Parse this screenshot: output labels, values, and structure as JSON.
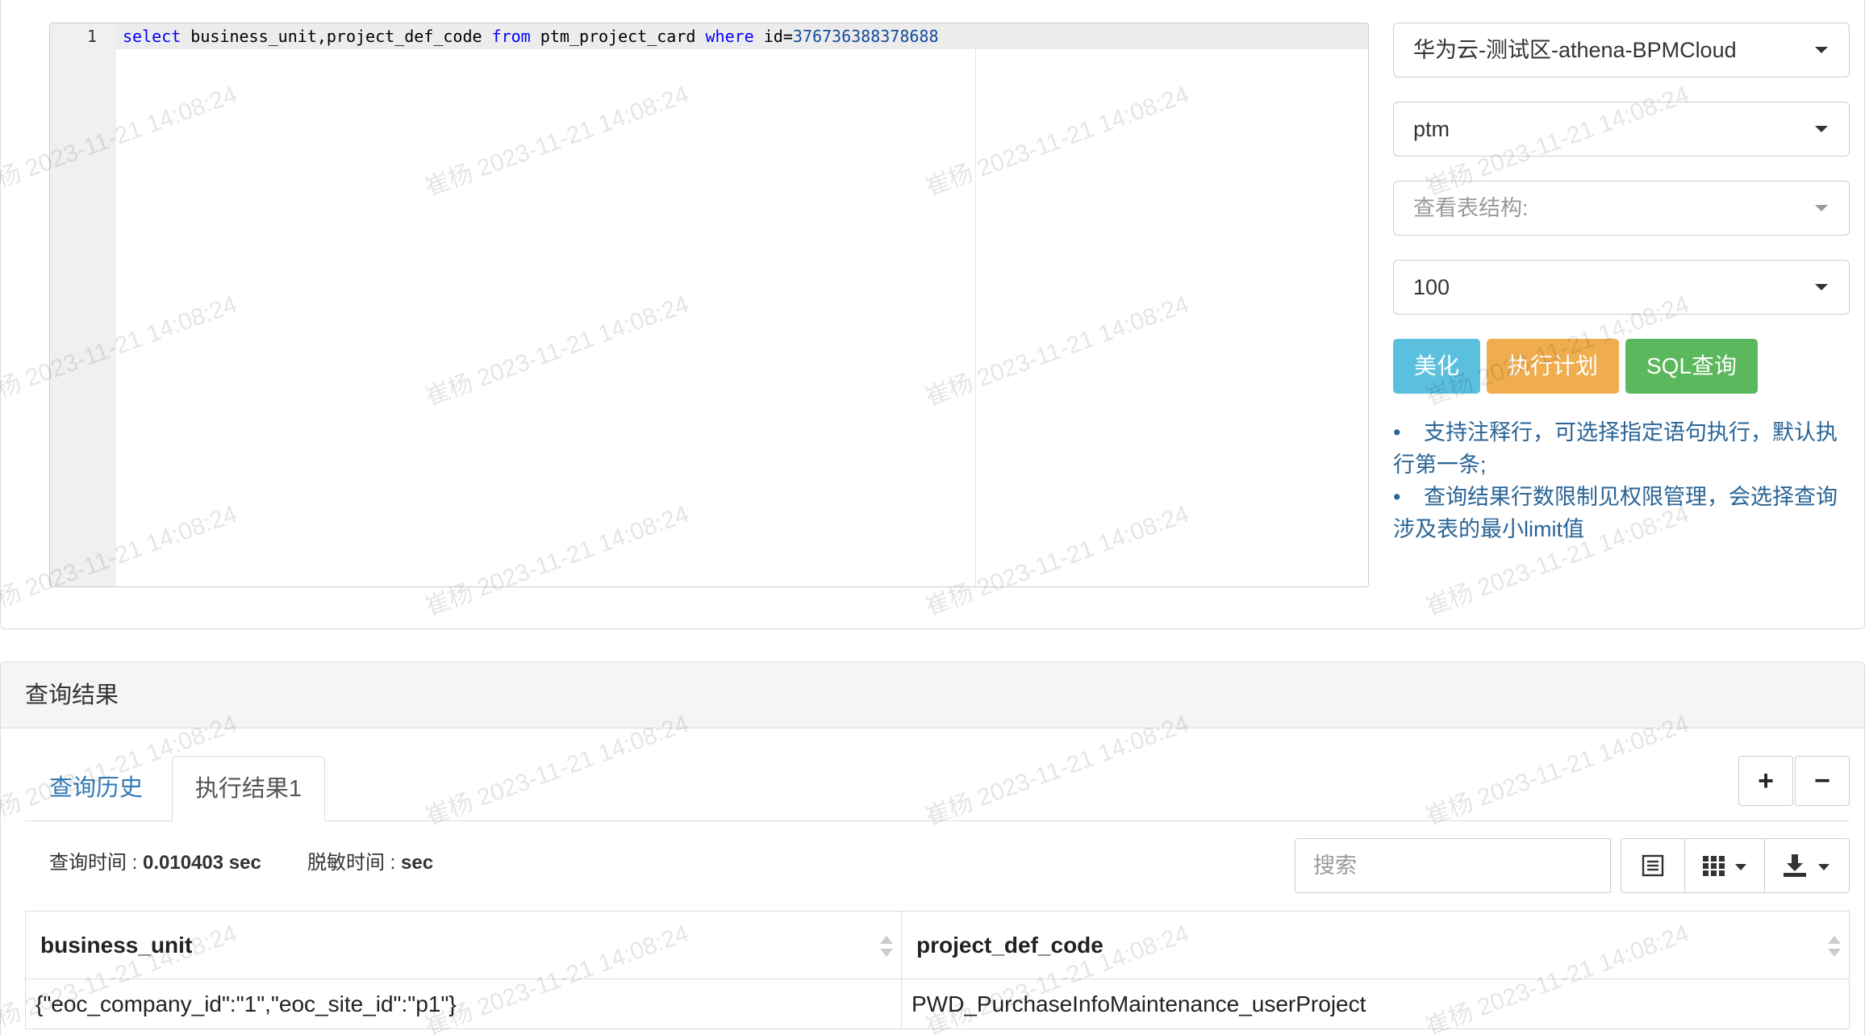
{
  "editor": {
    "line_number": "1",
    "code_tokens": [
      {
        "text": "select",
        "type": "keyword"
      },
      {
        "text": " business_unit,project_def_code ",
        "type": "plain"
      },
      {
        "text": "from",
        "type": "keyword"
      },
      {
        "text": " ptm_project_card ",
        "type": "plain"
      },
      {
        "text": "where",
        "type": "keyword"
      },
      {
        "text": " id=",
        "type": "plain"
      },
      {
        "text": "376736388378688",
        "type": "number"
      }
    ]
  },
  "controls": {
    "instance_select": "华为云-测试区-athena-BPMCloud",
    "database_select": "ptm",
    "table_structure_placeholder": "查看表结构:",
    "limit_select": "100",
    "beautify_label": "美化",
    "explain_label": "执行计划",
    "sql_query_label": "SQL查询"
  },
  "tips": [
    "支持注释行，可选择指定语句执行，默认执行第一条;",
    "查询结果行数限制见权限管理，会选择查询涉及表的最小limit值"
  ],
  "result": {
    "title": "查询结果",
    "tabs": [
      {
        "label": "查询历史",
        "active": false
      },
      {
        "label": "执行结果1",
        "active": true
      }
    ],
    "plus_label": "+",
    "minus_label": "−",
    "query_time_label": "查询时间 : ",
    "query_time_value": "0.010403 sec",
    "mask_time_label": "脱敏时间 : ",
    "mask_time_value": "sec",
    "search_placeholder": "搜索",
    "columns": [
      "business_unit",
      "project_def_code"
    ],
    "rows": [
      [
        "{\"eoc_company_id\":\"1\",\"eoc_site_id\":\"p1\"}",
        "PWD_PurchaseInfoMaintenance_userProject"
      ]
    ]
  },
  "watermark": {
    "text": "崔杨 2023-11-21 14:08:24",
    "color": "#000000"
  },
  "colors": {
    "beautify": "#5bc0de",
    "explain": "#f0ad4e",
    "sql_query": "#5cb85c",
    "link": "#337ab7",
    "tip_text": "#2a6496",
    "keyword": "#0000ff"
  }
}
